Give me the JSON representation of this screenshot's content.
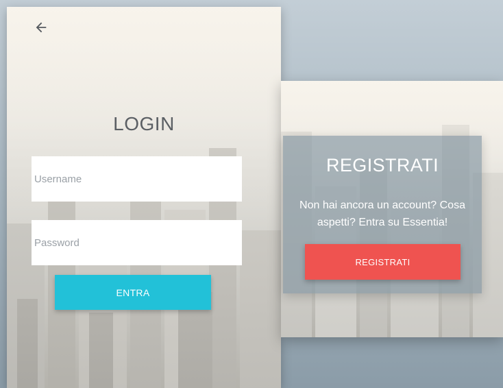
{
  "login": {
    "back_icon": "arrow-left-icon",
    "title": "LOGIN",
    "username_placeholder": "Username",
    "password_placeholder": "Password",
    "submit_label": "ENTRA"
  },
  "register": {
    "title": "REGISTRATI",
    "description": "Non hai ancora un account? Cosa aspetti? Entra su Essentia!",
    "button_label": "REGISTRATI"
  },
  "colors": {
    "login_button": "#22c1d8",
    "register_button": "#ef5350",
    "title_text": "#5b5f64"
  }
}
